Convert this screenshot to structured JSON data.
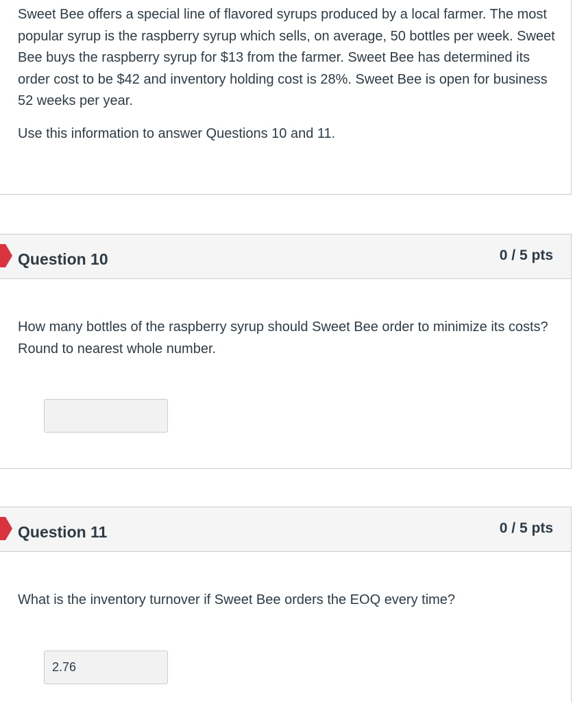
{
  "intro": {
    "paragraph": "Sweet Bee offers a special line of flavored syrups produced by a local farmer. The most popular syrup is the raspberry syrup which sells, on average, 50 bottles per week. Sweet Bee buys the raspberry syrup for $13 from the farmer. Sweet Bee has determined its order cost to be $42 and inventory holding cost is 28%. Sweet Bee is open for business 52 weeks per year.",
    "instruction": "Use this information to answer Questions 10 and 11."
  },
  "questions": [
    {
      "title": "Question 10",
      "points": "0 / 5 pts",
      "text": "How many bottles of the raspberry syrup should Sweet Bee order to minimize its costs? Round to nearest whole number.",
      "answer": ""
    },
    {
      "title": "Question 11",
      "points": "0 / 5 pts",
      "text": "What is the inventory turnover if Sweet Bee orders the EOQ every time?",
      "answer": "2.76"
    }
  ],
  "colors": {
    "incorrect_marker": "#d9333f",
    "header_bg": "#f5f5f5",
    "border": "#c7cdd1",
    "text": "#2d3b45"
  },
  "icons": {
    "incorrect_marker": "incorrect-flag-icon"
  }
}
